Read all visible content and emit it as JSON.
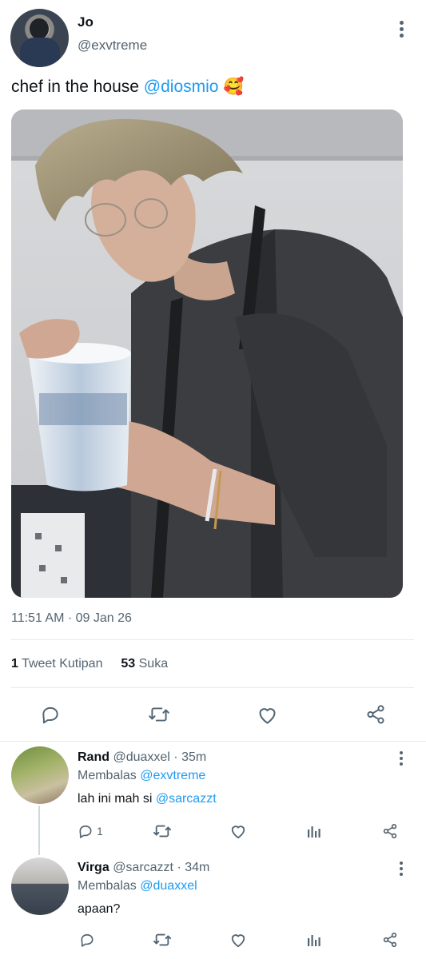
{
  "tweet": {
    "author_name": "Jo",
    "author_handle": "@exvtreme",
    "text_prefix": "chef in the house ",
    "mention": "@diosmio",
    "emoji": "🥰",
    "timestamp": "11:51 AM · 09 Jan 26",
    "quotes_count": "1",
    "quotes_label": "Tweet Kutipan",
    "likes_count": "53",
    "likes_label": "Suka"
  },
  "icons": {
    "reply": "reply-icon",
    "retweet": "retweet-icon",
    "like": "heart-icon",
    "share": "share-icon",
    "views": "analytics-icon",
    "more": "more-icon"
  },
  "replies": [
    {
      "name": "Rand",
      "handle": "@duaxxel",
      "time": "· 35m",
      "replying_label": "Membalas",
      "replying_to": "@exvtreme",
      "text_prefix": "lah ini mah si ",
      "text_mention": "@sarcazzt",
      "reply_count": "1"
    },
    {
      "name": "Virga",
      "handle": "@sarcazzt",
      "time": "· 34m",
      "replying_label": "Membalas",
      "replying_to": "@duaxxel",
      "text": "apaan?"
    }
  ],
  "colors": {
    "accent": "#1d9bf0",
    "secondary_text": "#536471",
    "divider": "#e6e9ea"
  }
}
